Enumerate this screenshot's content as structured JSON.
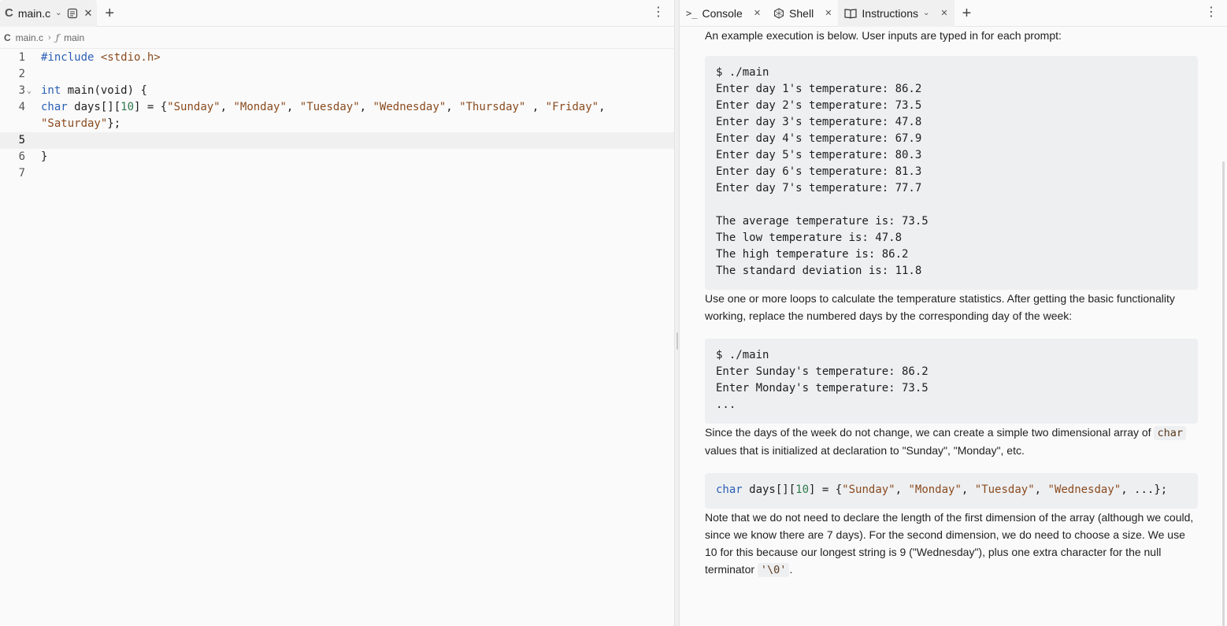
{
  "left": {
    "tab": {
      "label": "main.c"
    },
    "breadcrumb": {
      "file": "main.c",
      "symbol": "main"
    },
    "lines": [
      {
        "n": "1"
      },
      {
        "n": "2"
      },
      {
        "n": "3"
      },
      {
        "n": "4"
      },
      {
        "n": ""
      },
      {
        "n": "5"
      },
      {
        "n": "6"
      },
      {
        "n": "7"
      }
    ],
    "code": {
      "l1_pp": "#include ",
      "l1_inc": "<stdio.h>",
      "l3_kw": "int",
      "l3_rest": " main(void) {",
      "l4_kw": "char",
      "l4_a": " days[][",
      "l4_num": "10",
      "l4_b": "] = {",
      "s_sun": "\"Sunday\"",
      "s_mon": "\"Monday\"",
      "s_tue": "\"Tuesday\"",
      "s_wed": "\"Wednesday\"",
      "s_thu": "\"Thursday\"",
      "s_fri": "\"Friday\"",
      "s_sat": "\"Saturday\"",
      "comma": ", ",
      "comma_sp": " , ",
      "comma_end": ",",
      "close": "};",
      "brace": "}"
    }
  },
  "right": {
    "tabs": [
      {
        "label": "Console"
      },
      {
        "label": "Shell"
      },
      {
        "label": "Instructions"
      }
    ],
    "intro": "An example execution is below. User inputs are typed in for each prompt:",
    "pre1": "$ ./main\nEnter day 1's temperature: 86.2\nEnter day 2's temperature: 73.5\nEnter day 3's temperature: 47.8\nEnter day 4's temperature: 67.9\nEnter day 5's temperature: 80.3\nEnter day 6's temperature: 81.3\nEnter day 7's temperature: 77.7\n\nThe average temperature is: 73.5\nThe low temperature is: 47.8\nThe high temperature is: 86.2\nThe standard deviation is: 11.8",
    "para1": "Use one or more loops to calculate the temperature statistics. After getting the basic functionality working, replace the numbered days by the corresponding day of the week:",
    "pre2": "$ ./main\nEnter Sunday's temperature: 86.2\nEnter Monday's temperature: 73.5\n...",
    "para2_a": "Since the days of the week do not change, we can create a simple two dimensional array of ",
    "para2_code": "char",
    "para2_b": " values that is initialized at declaration to \"Sunday\", \"Monday\", etc.",
    "pre3": {
      "kw": "char",
      "a": " days[][",
      "num": "10",
      "b": "] = {",
      "s1": "\"Sunday\"",
      "s2": "\"Monday\"",
      "s3": "\"Tuesday\"",
      "s4": "\"Wednesday\"",
      "sep": ", ",
      "tail": ", ...};"
    },
    "para3_a": "Note that we do not need to declare the length of the first dimension of the array (although we could, since we know there are 7 days). For the second dimension, we do need to choose a size. We use 10 for this because our longest string is 9 (\"Wednesday\"), plus one extra character for the null terminator ",
    "para3_code": "'\\0'",
    "para3_b": "."
  }
}
